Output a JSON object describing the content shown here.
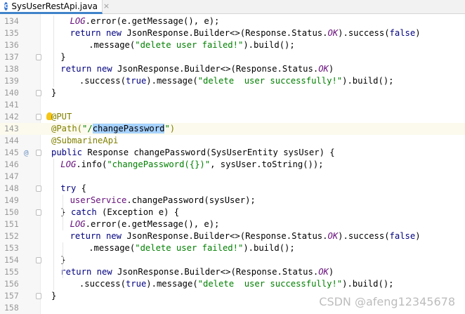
{
  "tab": {
    "icon_letter": "c",
    "title": "SysUserRestApi.java",
    "close": "×"
  },
  "lines": [
    {
      "n": "134",
      "indent": 2,
      "tokens": [
        [
          "const",
          "LOG"
        ],
        [
          "plain",
          ".error(e.getMessage(), e);"
        ]
      ]
    },
    {
      "n": "135",
      "indent": 2,
      "tokens": [
        [
          "kw",
          "return new "
        ],
        [
          "plain",
          "JsonResponse.Builder<>(Response.Status."
        ],
        [
          "const",
          "OK"
        ],
        [
          "plain",
          ").success("
        ],
        [
          "kw",
          "false"
        ],
        [
          "plain",
          ")"
        ]
      ]
    },
    {
      "n": "136",
      "indent": 4,
      "tokens": [
        [
          "plain",
          ".message("
        ],
        [
          "str",
          "\"delete user failed!\""
        ],
        [
          "plain",
          ").build();"
        ]
      ]
    },
    {
      "n": "137",
      "indent": 1,
      "fold": true,
      "tokens": [
        [
          "plain",
          "}"
        ]
      ]
    },
    {
      "n": "138",
      "indent": 1,
      "tokens": [
        [
          "kw",
          "return new "
        ],
        [
          "plain",
          "JsonResponse.Builder<>(Response.Status."
        ],
        [
          "const",
          "OK"
        ],
        [
          "plain",
          ")"
        ]
      ]
    },
    {
      "n": "139",
      "indent": 3,
      "tokens": [
        [
          "plain",
          ".success("
        ],
        [
          "kw",
          "true"
        ],
        [
          "plain",
          ").message("
        ],
        [
          "str",
          "\"delete  user successfully!\""
        ],
        [
          "plain",
          ").build();"
        ]
      ]
    },
    {
      "n": "140",
      "indent": 0,
      "fold": true,
      "tokens": [
        [
          "plain",
          "}"
        ]
      ]
    },
    {
      "n": "141",
      "indent": 0,
      "tokens": []
    },
    {
      "n": "142",
      "indent": 0,
      "fold": true,
      "bulb": true,
      "tokens": [
        [
          "ann",
          "@PUT"
        ]
      ]
    },
    {
      "n": "143",
      "indent": 0,
      "current": true,
      "tokens": [
        [
          "ann",
          "@Path("
        ],
        [
          "str",
          "\"/"
        ],
        [
          "sel",
          "changePassword"
        ],
        [
          "str",
          "\""
        ],
        [
          "ann",
          ")"
        ]
      ]
    },
    {
      "n": "144",
      "indent": 0,
      "tokens": [
        [
          "ann",
          "@SubmarineApi"
        ]
      ]
    },
    {
      "n": "145",
      "indent": 0,
      "mark": "@",
      "fold": true,
      "tokens": [
        [
          "kw",
          "public "
        ],
        [
          "plain",
          "Response "
        ],
        [
          "plain",
          "changePassword(SysUserEntity sysUser) {"
        ]
      ]
    },
    {
      "n": "146",
      "indent": 1,
      "tokens": [
        [
          "const",
          "LOG"
        ],
        [
          "plain",
          ".info("
        ],
        [
          "str",
          "\"changePassword({})\""
        ],
        [
          "plain",
          ", sysUser.toString());"
        ]
      ]
    },
    {
      "n": "147",
      "indent": 0,
      "tokens": []
    },
    {
      "n": "148",
      "indent": 1,
      "fold": true,
      "tokens": [
        [
          "kw",
          "try "
        ],
        [
          "plain",
          "{"
        ]
      ]
    },
    {
      "n": "149",
      "indent": 2,
      "tokens": [
        [
          "field",
          "userService"
        ],
        [
          "plain",
          ".changePassword(sysUser);"
        ]
      ]
    },
    {
      "n": "150",
      "indent": 1,
      "fold": true,
      "tokens": [
        [
          "plain",
          "} "
        ],
        [
          "kw",
          "catch "
        ],
        [
          "plain",
          "(Exception e) {"
        ]
      ]
    },
    {
      "n": "151",
      "indent": 2,
      "tokens": [
        [
          "const",
          "LOG"
        ],
        [
          "plain",
          ".error(e.getMessage(), e);"
        ]
      ]
    },
    {
      "n": "152",
      "indent": 2,
      "tokens": [
        [
          "kw",
          "return new "
        ],
        [
          "plain",
          "JsonResponse.Builder<>(Response.Status."
        ],
        [
          "const",
          "OK"
        ],
        [
          "plain",
          ").success("
        ],
        [
          "kw",
          "false"
        ],
        [
          "plain",
          ")"
        ]
      ]
    },
    {
      "n": "153",
      "indent": 4,
      "tokens": [
        [
          "plain",
          ".message("
        ],
        [
          "str",
          "\"delete user failed!\""
        ],
        [
          "plain",
          ").build();"
        ]
      ]
    },
    {
      "n": "154",
      "indent": 1,
      "fold": true,
      "tokens": [
        [
          "plain",
          "}"
        ]
      ]
    },
    {
      "n": "155",
      "indent": 1,
      "tokens": [
        [
          "kw",
          "return new "
        ],
        [
          "plain",
          "JsonResponse.Builder<>(Response.Status."
        ],
        [
          "const",
          "OK"
        ],
        [
          "plain",
          ")"
        ]
      ]
    },
    {
      "n": "156",
      "indent": 3,
      "tokens": [
        [
          "plain",
          ".success("
        ],
        [
          "kw",
          "true"
        ],
        [
          "plain",
          ").message("
        ],
        [
          "str",
          "\"delete  user successfully!\""
        ],
        [
          "plain",
          ").build();"
        ]
      ]
    },
    {
      "n": "157",
      "indent": 0,
      "fold": true,
      "tokens": [
        [
          "plain",
          "}"
        ]
      ]
    },
    {
      "n": "158",
      "indent": 0,
      "tokens": []
    }
  ],
  "watermark": "CSDN @afeng12345678",
  "colors": {
    "keyword": "#000080",
    "string": "#008000",
    "constant": "#660e7a",
    "annotation": "#808000",
    "selection": "#a6d2ff",
    "current_line": "#fcfaed"
  }
}
